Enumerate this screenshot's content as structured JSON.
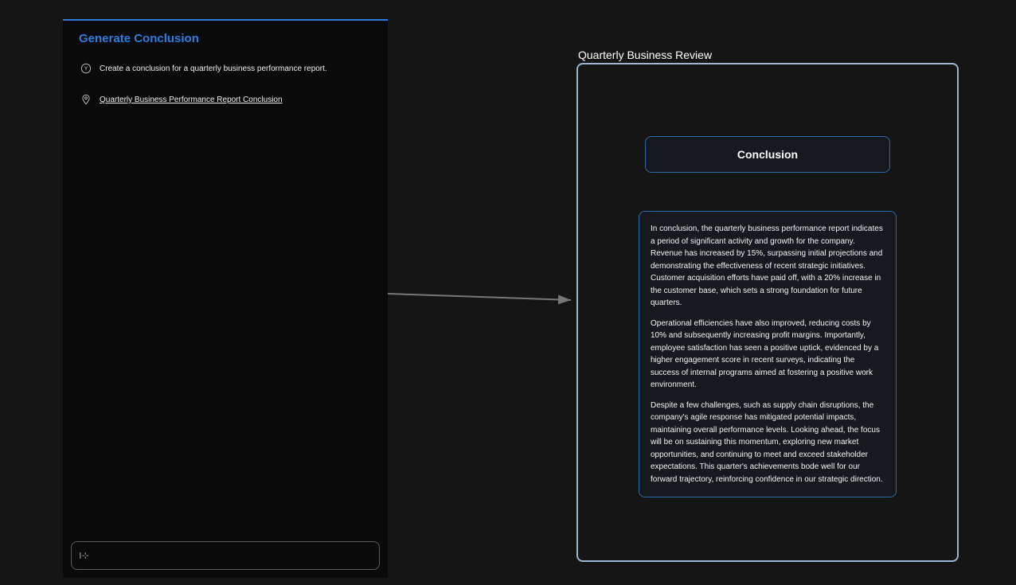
{
  "left": {
    "title": "Generate Conclusion",
    "user_message": "Create a conclusion for a quarterly business performance report.",
    "assistant_message": "Quarterly Business Performance Report Conclusion",
    "input_placeholder": ""
  },
  "right": {
    "title": "Quarterly Business Review",
    "heading": "Conclusion",
    "para1": "In conclusion, the quarterly business performance report indicates a period of significant activity and growth for the company. Revenue has increased by 15%, surpassing initial projections and demonstrating the effectiveness of recent strategic initiatives. Customer acquisition efforts have paid off, with a 20% increase in the customer base, which sets a strong foundation for future quarters.",
    "para2": "Operational efficiencies have also improved, reducing costs by 10% and subsequently increasing profit margins. Importantly, employee satisfaction has seen a positive uptick, evidenced by a higher engagement score in recent surveys, indicating the success of internal programs aimed at fostering a positive work environment.",
    "para3": "Despite a few challenges, such as supply chain disruptions, the company's agile response has mitigated potential impacts, maintaining overall performance levels. Looking ahead, the focus will be on sustaining this momentum, exploring new market opportunities, and continuing to meet and exceed stakeholder expectations. This quarter's achievements bode well for our forward trajectory, reinforcing confidence in our strategic direction."
  },
  "icons": {
    "user": "user-avatar-icon",
    "assistant": "location-pin-icon",
    "cursor": "text-cursor-icon"
  }
}
